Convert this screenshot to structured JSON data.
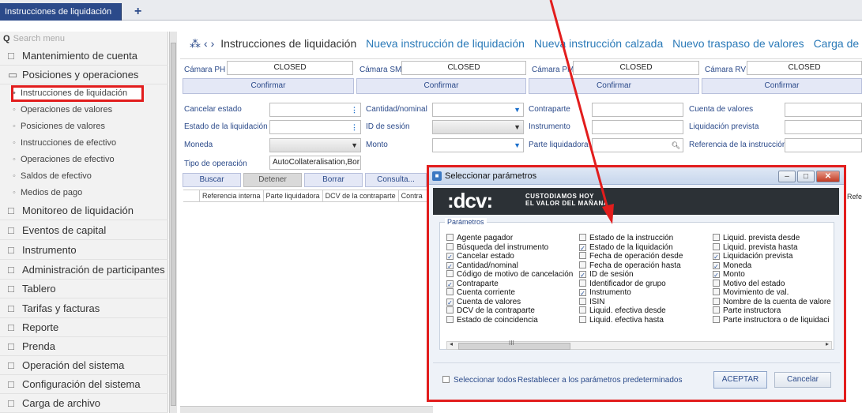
{
  "top_tab": {
    "label": "Instrucciones de liquidación",
    "add": "+"
  },
  "sidebar": {
    "search_placeholder": "Search menu",
    "items": [
      "Mantenimiento de cuenta",
      "Posiciones y operaciones",
      "Monitoreo de liquidación",
      "Eventos de capital",
      "Instrumento",
      "Administración de participantes",
      "Tablero",
      "Tarifas y facturas",
      "Reporte",
      "Prenda",
      "Operación del sistema",
      "Configuración del sistema",
      "Carga de archivo"
    ],
    "subitems": [
      "Instrucciones de liquidación",
      "Operaciones de valores",
      "Posiciones de valores",
      "Instrucciones de efectivo",
      "Operaciones de efectivo",
      "Saldos de efectivo",
      "Medios de pago"
    ]
  },
  "breadcrumb": {
    "current": "Instrucciones de liquidación",
    "links": [
      "Nueva instrucción de liquidación",
      "Nueva instrucción calzada",
      "Nuevo traspaso de valores",
      "Carga de archivo"
    ]
  },
  "cameras": [
    {
      "label": "Cámara PH",
      "status": "CLOSED",
      "confirm": "Confirmar"
    },
    {
      "label": "Cámara SM",
      "status": "CLOSED",
      "confirm": "Confirmar"
    },
    {
      "label": "Cámara PM",
      "status": "CLOSED",
      "confirm": "Confirmar"
    },
    {
      "label": "Cámara RV",
      "status": "CLOSED",
      "confirm": "Confirmar"
    }
  ],
  "filters": {
    "cancelar_estado": "Cancelar estado",
    "estado_liquidacion": "Estado de la liquidación",
    "moneda": "Moneda",
    "tipo_operacion": "Tipo de operación",
    "tipo_operacion_value": "AutoCollateralisation,Bor",
    "cantidad_nominal": "Cantidad/nominal",
    "id_sesion": "ID de sesión",
    "monto": "Monto",
    "contraparte": "Contraparte",
    "instrumento": "Instrumento",
    "parte_liquidadora": "Parte liquidadora",
    "cuenta_valores": "Cuenta de valores",
    "liquidacion_prevista": "Liquidación prevista",
    "referencia_instruccion": "Referencia de la instrucción"
  },
  "actions": {
    "buscar": "Buscar",
    "detener": "Detener",
    "borrar": "Borrar",
    "consulta": "Consulta..."
  },
  "table_headers": [
    "Referencia interna",
    "Parte liquidadora",
    "DCV de la contraparte",
    "Contra"
  ],
  "table_right_header": "Refe",
  "modal": {
    "title": "Seleccionar parámetros",
    "logo": ":dcv:",
    "tagline_1": "CUSTODIAMOS HOY",
    "tagline_2": "EL VALOR DEL MAÑANA",
    "params_label": "Parámetros",
    "columns": [
      [
        {
          "label": "Agente pagador",
          "checked": false
        },
        {
          "label": "Búsqueda del instrumento",
          "checked": false
        },
        {
          "label": "Cancelar estado",
          "checked": true
        },
        {
          "label": "Cantidad/nominal",
          "checked": true
        },
        {
          "label": "Código de motivo de cancelación",
          "checked": false
        },
        {
          "label": "Contraparte",
          "checked": true
        },
        {
          "label": "Cuenta corriente",
          "checked": false
        },
        {
          "label": "Cuenta de valores",
          "checked": true
        },
        {
          "label": "DCV de la contraparte",
          "checked": false
        },
        {
          "label": "Estado de coincidencia",
          "checked": false
        }
      ],
      [
        {
          "label": "Estado de la instrucción",
          "checked": false
        },
        {
          "label": "Estado de la liquidación",
          "checked": true
        },
        {
          "label": "Fecha de operación desde",
          "checked": false
        },
        {
          "label": "Fecha de operación hasta",
          "checked": false
        },
        {
          "label": "ID de sesión",
          "checked": true
        },
        {
          "label": "Identificador de grupo",
          "checked": false
        },
        {
          "label": "Instrumento",
          "checked": true
        },
        {
          "label": "ISIN",
          "checked": false
        },
        {
          "label": "Liquid. efectiva desde",
          "checked": false
        },
        {
          "label": "Liquid. efectiva hasta",
          "checked": false
        }
      ],
      [
        {
          "label": "Liquid. prevista desde",
          "checked": false
        },
        {
          "label": "Liquid. prevista hasta",
          "checked": false
        },
        {
          "label": "Liquidación prevista",
          "checked": true
        },
        {
          "label": "Moneda",
          "checked": true
        },
        {
          "label": "Monto",
          "checked": true
        },
        {
          "label": "Motivo del estado",
          "checked": false
        },
        {
          "label": "Movimiento de val.",
          "checked": false
        },
        {
          "label": "Nombre de la cuenta de valore",
          "checked": false
        },
        {
          "label": "Parte instructora",
          "checked": false
        },
        {
          "label": "Parte instructora o de liquidaci",
          "checked": false
        }
      ]
    ],
    "select_all": "Seleccionar todos",
    "reset": "Restablecer a los parámetros predeterminados",
    "accept": "ACEPTAR",
    "cancel": "Cancelar"
  },
  "colors": {
    "accent_red": "#e21d1d",
    "brand_blue": "#2b4a8a",
    "link_blue": "#2b7ab8",
    "banner_dark": "#2c3136"
  }
}
